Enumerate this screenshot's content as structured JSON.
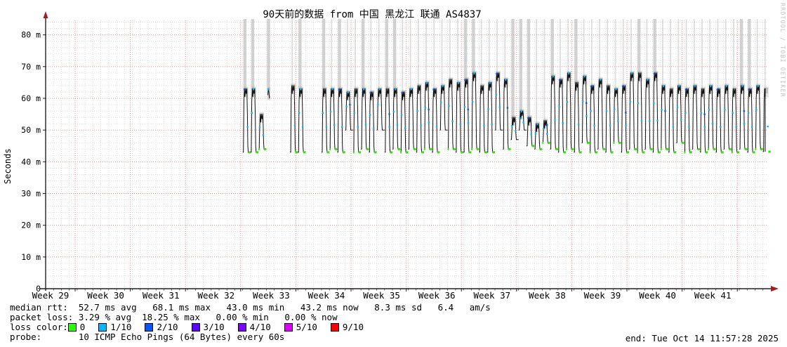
{
  "title": "90天前的数据 from 中国 黑龙江 联通 AS4837",
  "watermark": "RRDTOOL / TOBI OETIKER",
  "end_text": "end: Tue Oct 14 11:57:28 2025",
  "stats": {
    "median_rtt_line": "median rtt:  52.7 ms avg   68.1 ms max   43.0 ms min   43.2 ms now   8.3 ms sd   6.4   am/s",
    "packet_loss_line": "packet loss: 3.29 % avg  18.25 % max   0.00 % min   0.00 % now",
    "loss_color_label": "loss color:",
    "probe_line": "probe:       10 ICMP Echo Pings (64 Bytes) every 60s",
    "median_rtt": {
      "avg": "52.7 ms",
      "max": "68.1 ms",
      "min": "43.0 ms",
      "now": "43.2 ms",
      "sd": "8.3 ms",
      "am_s": "6.4"
    },
    "packet_loss": {
      "avg": "3.29 %",
      "max": "18.25 %",
      "min": "0.00 %",
      "now": "0.00 %"
    }
  },
  "loss_legend": [
    {
      "label": "0",
      "color": "#26ff00"
    },
    {
      "label": "1/10",
      "color": "#00b8ff"
    },
    {
      "label": "2/10",
      "color": "#0059ff"
    },
    {
      "label": "3/10",
      "color": "#5e00ff"
    },
    {
      "label": "4/10",
      "color": "#7e00ff"
    },
    {
      "label": "5/10",
      "color": "#dd00ff"
    },
    {
      "label": "9/10",
      "color": "#ff0000"
    }
  ],
  "colors": {
    "median_line": "#111111",
    "smoke": "#8a8a8a",
    "loss_band": "#b4b4b4",
    "grid_minor": "#d4d4d4",
    "grid_major": "#f08080",
    "axis": "#222222",
    "axis_arrow": "#a02020",
    "dot_green": "#2ce800",
    "dot_cyan": "#00b8ff",
    "dot_blue": "#0059ff"
  },
  "chart_data": {
    "type": "line",
    "subtype": "smokeping-latency",
    "title": "90天前的数据 from 中国 黑龙江 联通 AS4837",
    "xlabel": "",
    "ylabel": "Seconds",
    "ylim": [
      0,
      85
    ],
    "y_unit": "milliseconds ('m' suffix)",
    "grid": true,
    "legend_position": "bottom",
    "y_ticks": [
      "0",
      "10 m",
      "20 m",
      "30 m",
      "40 m",
      "50 m",
      "60 m",
      "70 m",
      "80 m"
    ],
    "x_ticks": [
      "Week 29",
      "Week 30",
      "Week 31",
      "Week 32",
      "Week 33",
      "Week 34",
      "Week 35",
      "Week 36",
      "Week 37",
      "Week 38",
      "Week 39",
      "Week 40",
      "Week 41"
    ],
    "series_name": "median ICMP round-trip time",
    "days_note": "92 daily slots spanning the 90-day window (left edge = day 0, 'now' = right edge). Each slot is null (no data) or [daytime_peak_ms, night_trough_ms, loss_band] where loss_band 0=none, 1=thin grey loss column, 2=wide grey loss column. Entries with trough>55 are brief data blips.",
    "days": [
      null,
      null,
      null,
      null,
      null,
      null,
      null,
      null,
      null,
      null,
      null,
      null,
      null,
      null,
      null,
      null,
      null,
      null,
      null,
      null,
      null,
      null,
      null,
      null,
      null,
      [
        63,
        43,
        2
      ],
      [
        63,
        43,
        2
      ],
      [
        55,
        44,
        0
      ],
      [
        63,
        61,
        2
      ],
      null,
      null,
      [
        64,
        43,
        1
      ],
      [
        63,
        43,
        2
      ],
      null,
      null,
      [
        63,
        43,
        2
      ],
      [
        63,
        44,
        1
      ],
      [
        63,
        43,
        2
      ],
      [
        62,
        50,
        1
      ],
      [
        63,
        43,
        1
      ],
      [
        63,
        44,
        2
      ],
      [
        62,
        43,
        1
      ],
      [
        63,
        50,
        1
      ],
      [
        63,
        43,
        2
      ],
      [
        63,
        44,
        2
      ],
      [
        62,
        43,
        1
      ],
      [
        63,
        44,
        1
      ],
      [
        64,
        43,
        1
      ],
      [
        65,
        44,
        1
      ],
      [
        63,
        43,
        1
      ],
      [
        64,
        50,
        1
      ],
      [
        66,
        44,
        1
      ],
      [
        65,
        43,
        1
      ],
      [
        66,
        43,
        2
      ],
      [
        68,
        44,
        2
      ],
      [
        64,
        43,
        1
      ],
      [
        65,
        43,
        1
      ],
      [
        68,
        50,
        1
      ],
      [
        66,
        44,
        1
      ],
      [
        54,
        47,
        2
      ],
      [
        56,
        50,
        2
      ],
      [
        54,
        45,
        2
      ],
      [
        52,
        44,
        1
      ],
      [
        53,
        46,
        1
      ],
      [
        67,
        44,
        2
      ],
      [
        66,
        43,
        1
      ],
      [
        68,
        44,
        1
      ],
      [
        65,
        43,
        2
      ],
      [
        67,
        46,
        1
      ],
      [
        64,
        43,
        1
      ],
      [
        66,
        44,
        1
      ],
      [
        64,
        43,
        1
      ],
      [
        63,
        46,
        1
      ],
      [
        64,
        43,
        1
      ],
      [
        68,
        44,
        1
      ],
      [
        68,
        43,
        2
      ],
      [
        66,
        44,
        1
      ],
      [
        68,
        43,
        2
      ],
      [
        64,
        44,
        1
      ],
      [
        63,
        43,
        1
      ],
      [
        64,
        46,
        1
      ],
      [
        63,
        43,
        1
      ],
      [
        64,
        44,
        1
      ],
      [
        63,
        43,
        1
      ],
      [
        64,
        44,
        1
      ],
      [
        63,
        43,
        1
      ],
      [
        64,
        44,
        1
      ],
      [
        63,
        43,
        1
      ],
      [
        64,
        44,
        2
      ],
      [
        63,
        43,
        2
      ],
      [
        64,
        44,
        1
      ],
      [
        63,
        43.2,
        1
      ]
    ]
  }
}
